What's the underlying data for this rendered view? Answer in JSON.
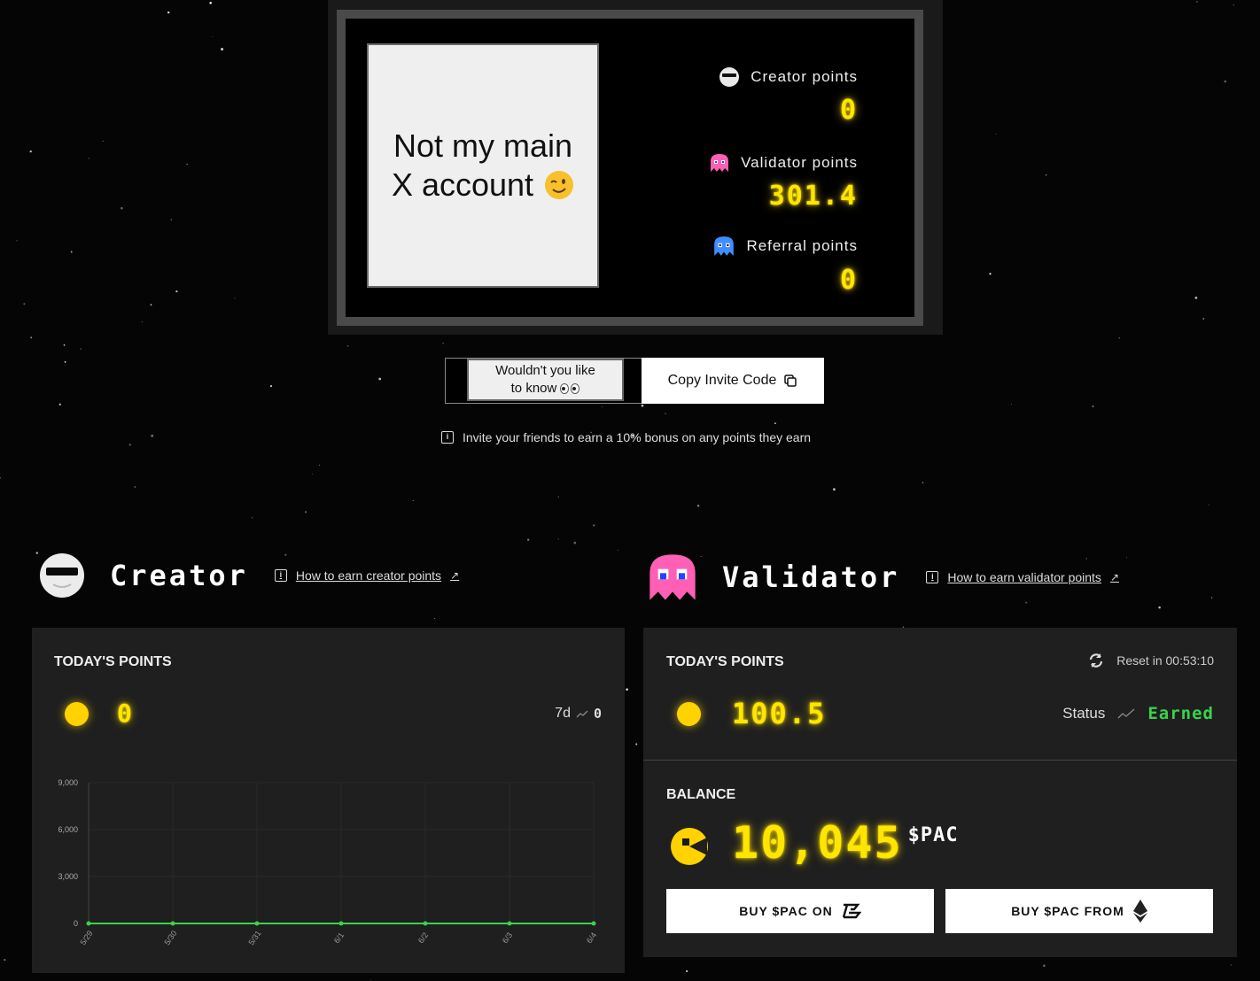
{
  "profile": {
    "avatar_text_line1": "Not my main",
    "avatar_text_line2": "X account",
    "creator_label": "Creator points",
    "creator_value": "0",
    "validator_label": "Validator points",
    "validator_value": "301.4",
    "referral_label": "Referral points",
    "referral_value": "0"
  },
  "invite": {
    "code_line1": "Wouldn't you like",
    "code_line2": "to know",
    "copy_label": "Copy Invite Code",
    "note": "Invite your friends to earn a 10% bonus on any points they earn"
  },
  "creator": {
    "title": "Creator",
    "howto": "How to earn creator points",
    "today_label": "TODAY'S POINTS",
    "today_value": "0",
    "range_label": "7d",
    "range_value": "0"
  },
  "validator": {
    "title": "Validator",
    "howto": "How to earn validator points",
    "today_label": "TODAY'S POINTS",
    "reset_label": "Reset in 00:53:10",
    "today_value": "100.5",
    "status_label": "Status",
    "status_value": "Earned",
    "balance_label": "BALANCE",
    "balance_value": "10,045",
    "balance_unit": "$PAC",
    "buy_on_label": "BUY $PAC ON",
    "buy_from_label": "BUY $PAC FROM"
  },
  "colors": {
    "accent_yellow": "#ffe600",
    "earned_green": "#3bd24a",
    "panel_bg": "#1f1f1f"
  },
  "chart_data": {
    "type": "line",
    "x": [
      "5/29",
      "5/30",
      "5/31",
      "6/1",
      "6/2",
      "6/3",
      "6/4"
    ],
    "series": [
      {
        "values": [
          0,
          0,
          0,
          0,
          0,
          0,
          0
        ]
      }
    ],
    "yticks": [
      0,
      3000,
      6000,
      9000
    ],
    "ylim": [
      0,
      9000
    ],
    "grid": true
  }
}
